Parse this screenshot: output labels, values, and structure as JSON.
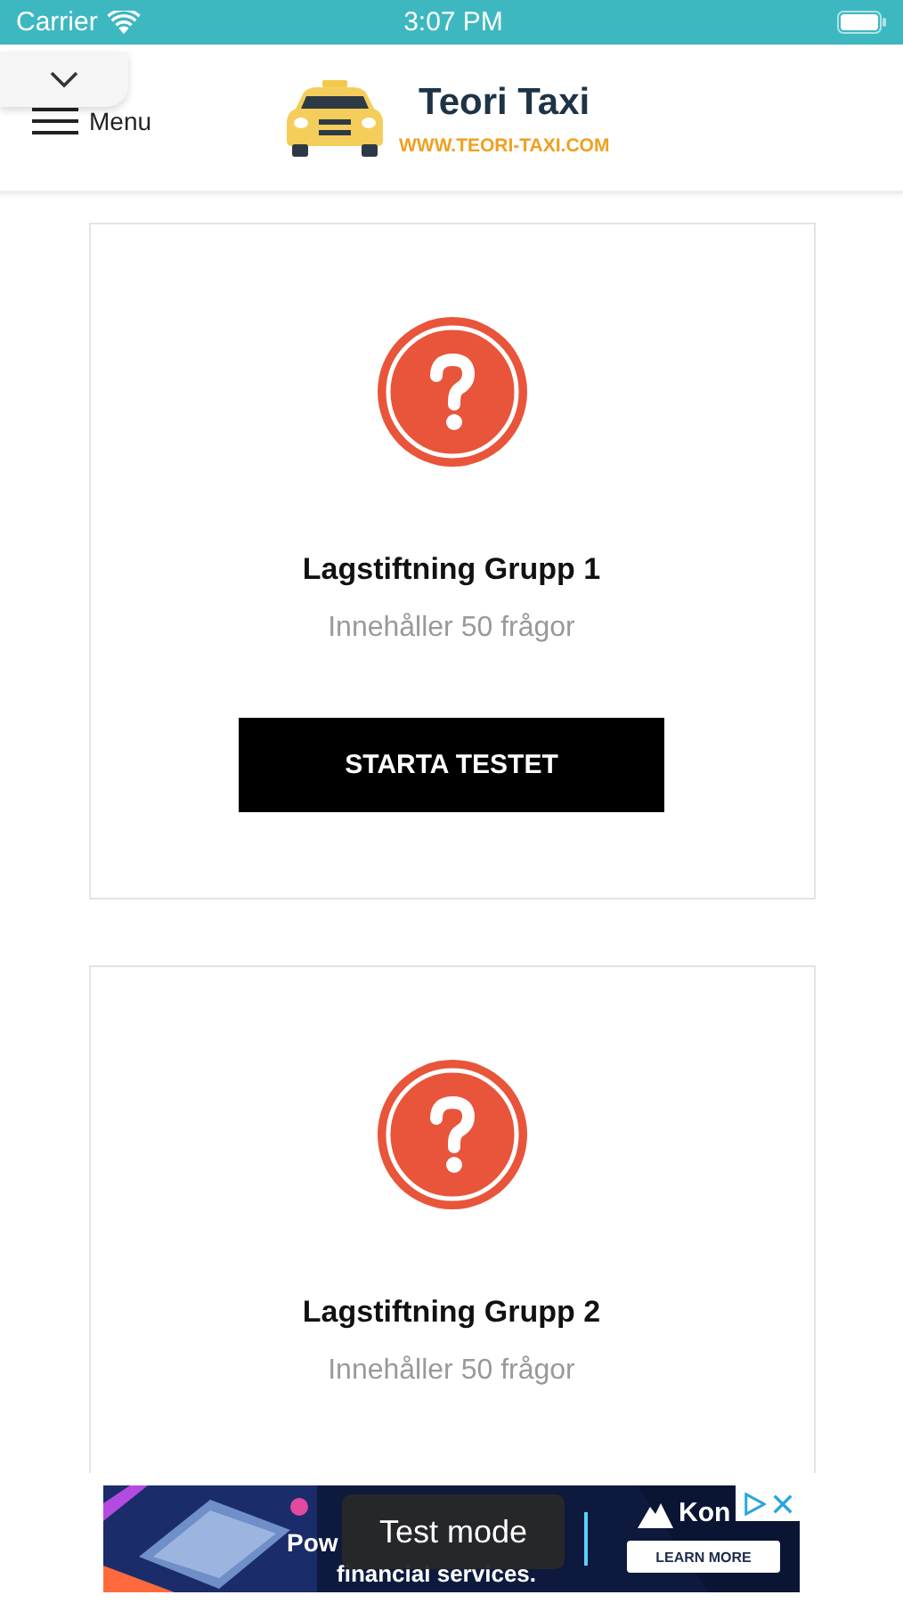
{
  "status_bar": {
    "carrier": "Carrier",
    "time": "3:07 PM"
  },
  "header": {
    "menu_label": "Menu",
    "logo_title": "Teori Taxi",
    "logo_url": "WWW.TEORI-TAXI.COM"
  },
  "cards": [
    {
      "title": "Lagstiftning Grupp 1",
      "subtitle": "Innehåller 50 frågor",
      "button": "STARTA TESTET"
    },
    {
      "title": "Lagstiftning Grupp 2",
      "subtitle": "Innehåller 50 frågor"
    }
  ],
  "ad": {
    "headline_start": "Pow",
    "headline_end": "financial services.",
    "brand": "Kon",
    "cta": "LEARN MORE",
    "toast": "Test mode"
  }
}
